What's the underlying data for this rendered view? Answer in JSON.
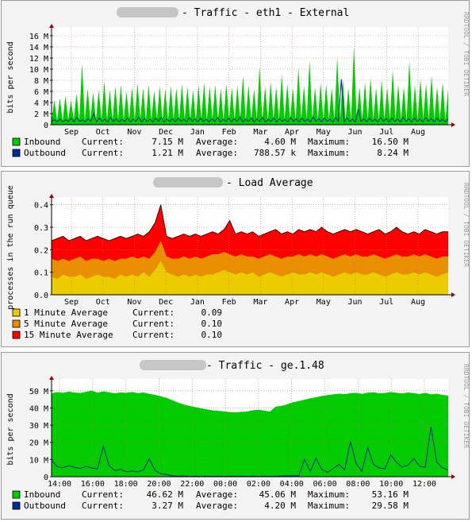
{
  "vertical_credit": "RRDTOOL / TOBI OETIKER",
  "colors": {
    "inbound": "#00cc00",
    "outbound": "#002a97",
    "load_1min": "#eacc00",
    "load_5min": "#ea8f00",
    "load_15min": "#ff0000",
    "grid_minor": "#e8a0a0",
    "grid_major": "#d07070",
    "axis_arrow": "#a00000"
  },
  "chart_data": [
    {
      "type": "area",
      "title": "- Traffic - eth1 - External",
      "ylabel": "bits per second",
      "ylim": [
        0,
        17000000
      ],
      "y_ticks": [
        {
          "v": 0,
          "label": "0"
        },
        {
          "v": 2000000,
          "label": "2 M"
        },
        {
          "v": 4000000,
          "label": "4 M"
        },
        {
          "v": 6000000,
          "label": "6 M"
        },
        {
          "v": 8000000,
          "label": "8 M"
        },
        {
          "v": 10000000,
          "label": "10 M"
        },
        {
          "v": 12000000,
          "label": "12 M"
        },
        {
          "v": 14000000,
          "label": "14 M"
        },
        {
          "v": 16000000,
          "label": "16 M"
        }
      ],
      "x_ticks": [
        "Sep",
        "Oct",
        "Nov",
        "Dec",
        "Jan",
        "Feb",
        "Mar",
        "Apr",
        "May",
        "Jun",
        "Jul",
        "Aug"
      ],
      "series": [
        {
          "name": "Inbound",
          "values": [
            0.6,
            4.5,
            0.8,
            4.8,
            0.7,
            5.2,
            0.9,
            4.4,
            1.0,
            5.6,
            0.8,
            11.0,
            0.7,
            6.5,
            0.9,
            5.8,
            0.8,
            6.2,
            1.0,
            7.8,
            0.9,
            6.3,
            0.8,
            6.9,
            1.0,
            7.2,
            0.9,
            6.0,
            1.0,
            6.8,
            0.9,
            7.5,
            1.0,
            6.6,
            0.8,
            7.2,
            0.9,
            6.1,
            1.0,
            6.9,
            0.9,
            6.4,
            0.8,
            7.0,
            1.0,
            6.6,
            0.9,
            7.3,
            1.0,
            6.8,
            0.9,
            6.2,
            0.8,
            7.1,
            1.0,
            7.6,
            0.9,
            6.9,
            1.0,
            7.2,
            0.9,
            6.5,
            0.8,
            7.4,
            1.0,
            6.7,
            0.9,
            7.0,
            1.0,
            8.8,
            0.8,
            7.1,
            0.9,
            6.4,
            1.0,
            10.5,
            0.9,
            6.9,
            0.8,
            7.7,
            1.0,
            6.8,
            0.9,
            9.1,
            1.0,
            7.4,
            0.9,
            6.6,
            0.8,
            10.2,
            1.0,
            7.0,
            0.9,
            11.6,
            1.0,
            6.7,
            0.9,
            7.5,
            0.8,
            7.3,
            1.0,
            6.6,
            0.9,
            12.2,
            1.0,
            8.2,
            0.9,
            6.6,
            0.8,
            14.2,
            1.0,
            6.8,
            0.9,
            7.6,
            1.0,
            8.4,
            0.9,
            6.6,
            0.8,
            8.1,
            1.0,
            6.7,
            0.9,
            9.8,
            1.0,
            7.2,
            0.9,
            6.8,
            0.8,
            11.5,
            1.0,
            7.1,
            0.9,
            8.3,
            1.0,
            7.4,
            0.9,
            8.9,
            0.8,
            6.9,
            1.0,
            7.6,
            0.9,
            6.4
          ],
          "current": "7.15 M",
          "average": "4.60 M",
          "maximum": "16.50 M"
        },
        {
          "name": "Outbound",
          "values": [
            0.6,
            0.9,
            0.5,
            1.0,
            0.5,
            0.9,
            0.6,
            1.2,
            0.5,
            1.3,
            0.6,
            0.9,
            0.5,
            1.1,
            0.6,
            2.0,
            0.5,
            1.2,
            0.6,
            1.0,
            0.5,
            1.3,
            0.6,
            1.1,
            0.5,
            1.0,
            0.6,
            1.2,
            0.5,
            1.0,
            0.6,
            1.4,
            0.5,
            1.1,
            0.6,
            1.0,
            0.5,
            1.2,
            0.6,
            1.3,
            0.5,
            1.0,
            0.6,
            1.1,
            0.5,
            1.2,
            0.6,
            1.0,
            0.5,
            1.3,
            0.6,
            1.1,
            0.5,
            1.2,
            0.6,
            1.0,
            0.5,
            1.1,
            0.6,
            1.3,
            0.5,
            1.0,
            0.6,
            1.2,
            0.5,
            1.1,
            0.6,
            1.4,
            0.5,
            1.0,
            0.6,
            1.2,
            0.5,
            1.1,
            0.6,
            1.3,
            0.5,
            1.0,
            0.6,
            1.2,
            0.5,
            1.1,
            0.6,
            1.0,
            0.5,
            1.3,
            0.6,
            1.1,
            0.5,
            1.2,
            0.6,
            1.0,
            0.5,
            1.4,
            0.6,
            1.1,
            0.5,
            1.2,
            0.6,
            1.0,
            0.5,
            1.3,
            0.6,
            8.2,
            0.5,
            1.2,
            0.6,
            1.0,
            0.5,
            2.8,
            0.6,
            1.1,
            0.5,
            1.2,
            0.6,
            1.0,
            0.5,
            1.3,
            0.6,
            1.1,
            0.5,
            1.2,
            0.6,
            1.0,
            0.5,
            1.4,
            0.6,
            1.1,
            0.5,
            1.2,
            0.6,
            1.0,
            0.5,
            1.3,
            0.6,
            1.1,
            0.5,
            1.2,
            0.6,
            1.0,
            0.5,
            1.1
          ],
          "current": "1.21 M",
          "average": "788.57 k",
          "maximum": "8.24 M"
        }
      ]
    },
    {
      "type": "area",
      "title": "- Load Average",
      "ylabel": "processes in the run queue",
      "ylim": [
        0,
        0.42
      ],
      "y_ticks": [
        {
          "v": 0,
          "label": "0.0"
        },
        {
          "v": 0.1,
          "label": "0.1"
        },
        {
          "v": 0.2,
          "label": "0.2"
        },
        {
          "v": 0.3,
          "label": "0.3"
        },
        {
          "v": 0.4,
          "label": "0.4"
        }
      ],
      "x_ticks": [
        "Sep",
        "Oct",
        "Nov",
        "Dec",
        "Jan",
        "Feb",
        "Mar",
        "Apr",
        "May",
        "Jun",
        "Jul",
        "Aug"
      ],
      "series": [
        {
          "name": "1 Minute Average",
          "values": [
            0.08,
            0.07,
            0.09,
            0.08,
            0.08,
            0.09,
            0.07,
            0.08,
            0.09,
            0.08,
            0.08,
            0.07,
            0.09,
            0.08,
            0.09,
            0.08,
            0.1,
            0.08,
            0.11,
            0.15,
            0.1,
            0.09,
            0.08,
            0.09,
            0.08,
            0.09,
            0.08,
            0.09,
            0.09,
            0.1,
            0.11,
            0.1,
            0.09,
            0.1,
            0.09,
            0.1,
            0.08,
            0.09,
            0.1,
            0.09,
            0.08,
            0.09,
            0.1,
            0.09,
            0.09,
            0.1,
            0.09,
            0.1,
            0.09,
            0.08,
            0.09,
            0.1,
            0.09,
            0.1,
            0.09,
            0.09,
            0.1,
            0.09,
            0.08,
            0.09,
            0.1,
            0.09,
            0.09,
            0.1,
            0.09,
            0.1,
            0.09,
            0.08,
            0.09,
            0.1
          ],
          "current": "0.09"
        },
        {
          "name": "5 Minute Average",
          "values": [
            0.16,
            0.15,
            0.16,
            0.15,
            0.16,
            0.17,
            0.15,
            0.16,
            0.16,
            0.15,
            0.16,
            0.15,
            0.16,
            0.16,
            0.17,
            0.16,
            0.17,
            0.16,
            0.19,
            0.24,
            0.17,
            0.16,
            0.16,
            0.17,
            0.16,
            0.17,
            0.16,
            0.17,
            0.18,
            0.18,
            0.19,
            0.18,
            0.17,
            0.18,
            0.17,
            0.17,
            0.16,
            0.17,
            0.18,
            0.17,
            0.16,
            0.17,
            0.17,
            0.18,
            0.17,
            0.18,
            0.17,
            0.18,
            0.17,
            0.16,
            0.17,
            0.18,
            0.17,
            0.18,
            0.17,
            0.17,
            0.18,
            0.17,
            0.16,
            0.17,
            0.18,
            0.17,
            0.17,
            0.18,
            0.17,
            0.18,
            0.17,
            0.16,
            0.17,
            0.17
          ],
          "current": "0.10"
        },
        {
          "name": "15 Minute Average",
          "values": [
            0.24,
            0.25,
            0.26,
            0.24,
            0.25,
            0.26,
            0.24,
            0.25,
            0.26,
            0.25,
            0.24,
            0.25,
            0.26,
            0.25,
            0.26,
            0.27,
            0.26,
            0.28,
            0.32,
            0.4,
            0.26,
            0.25,
            0.26,
            0.27,
            0.26,
            0.27,
            0.26,
            0.27,
            0.28,
            0.27,
            0.29,
            0.33,
            0.27,
            0.28,
            0.27,
            0.28,
            0.26,
            0.27,
            0.28,
            0.29,
            0.27,
            0.28,
            0.27,
            0.29,
            0.28,
            0.29,
            0.28,
            0.3,
            0.28,
            0.27,
            0.28,
            0.29,
            0.28,
            0.29,
            0.28,
            0.27,
            0.28,
            0.29,
            0.27,
            0.28,
            0.3,
            0.28,
            0.27,
            0.28,
            0.27,
            0.29,
            0.28,
            0.27,
            0.28,
            0.28
          ],
          "current": "0.10"
        }
      ]
    },
    {
      "type": "area",
      "title": "- Traffic - ge.1.48",
      "ylabel": "bits per second",
      "ylim": [
        0,
        55000000
      ],
      "y_ticks": [
        {
          "v": 0,
          "label": "0"
        },
        {
          "v": 10000000,
          "label": "10 M"
        },
        {
          "v": 20000000,
          "label": "20 M"
        },
        {
          "v": 30000000,
          "label": "30 M"
        },
        {
          "v": 40000000,
          "label": "40 M"
        },
        {
          "v": 50000000,
          "label": "50 M"
        }
      ],
      "x_ticks": [
        "14:00",
        "16:00",
        "18:00",
        "20:00",
        "22:00",
        "00:00",
        "02:00",
        "04:00",
        "06:00",
        "08:00",
        "10:00",
        "12:00"
      ],
      "series": [
        {
          "name": "Inbound",
          "values": [
            48.5,
            49.2,
            48.8,
            49.5,
            49.0,
            48.7,
            49.4,
            50.1,
            48.9,
            49.6,
            49.1,
            48.5,
            49.0,
            48.8,
            49.3,
            48.6,
            49.0,
            48.2,
            47.6,
            46.8,
            45.9,
            44.5,
            43.1,
            42.0,
            41.2,
            40.5,
            39.8,
            39.2,
            38.6,
            38.3,
            38.0,
            37.6,
            37.4,
            37.7,
            37.9,
            38.6,
            39.0,
            38.4,
            37.9,
            40.8,
            41.2,
            42.1,
            43.3,
            44.0,
            44.8,
            45.6,
            46.2,
            46.9,
            47.5,
            47.9,
            48.3,
            48.0,
            48.6,
            48.8,
            48.2,
            48.9,
            49.1,
            48.5,
            48.7,
            49.3,
            48.8,
            48.4,
            49.0,
            48.6,
            48.1,
            48.8,
            47.9,
            48.3,
            47.6,
            47.2
          ],
          "current": "46.62 M",
          "average": "45.06 M",
          "maximum": "53.16 M"
        },
        {
          "name": "Outbound",
          "values": [
            9.5,
            5.8,
            5.2,
            6.4,
            5.5,
            4.8,
            6.0,
            5.1,
            4.5,
            17.8,
            6.5,
            3.5,
            4.2,
            2.9,
            3.3,
            2.8,
            4.0,
            10.5,
            3.6,
            1.8,
            1.2,
            0.5,
            0.3,
            0.4,
            0.2,
            0.3,
            0.2,
            0.3,
            0.2,
            0.3,
            0.2,
            0.3,
            0.2,
            0.3,
            0.2,
            0.3,
            0.2,
            0.3,
            0.2,
            0.3,
            0.4,
            0.5,
            0.6,
            0.5,
            10.2,
            3.1,
            10.8,
            4.3,
            2.5,
            4.8,
            7.2,
            3.9,
            20.5,
            7.6,
            3.1,
            16.8,
            7.2,
            5.1,
            4.6,
            12.8,
            8.4,
            5.5,
            6.7,
            10.6,
            6.2,
            5.3,
            29.0,
            8.5,
            5.2,
            3.8
          ],
          "current": "3.27 M",
          "average": "4.20 M",
          "maximum": "29.58 M"
        }
      ]
    }
  ]
}
